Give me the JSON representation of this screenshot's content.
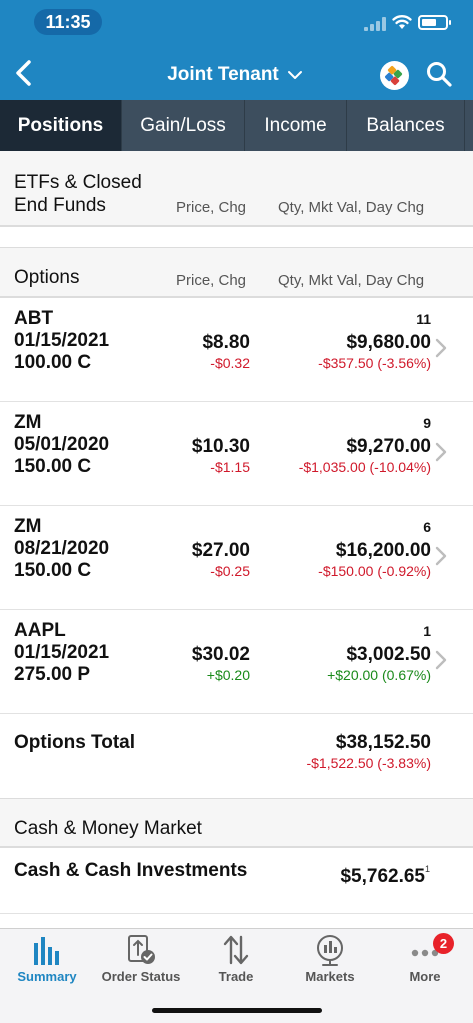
{
  "status_bar": {
    "time": "11:35"
  },
  "header": {
    "title": "Joint Tenant"
  },
  "tabs": [
    {
      "label": "Positions",
      "active": true
    },
    {
      "label": "Gain/Loss",
      "active": false
    },
    {
      "label": "Income",
      "active": false
    },
    {
      "label": "Balances",
      "active": false
    }
  ],
  "etfs": {
    "title_line1": "ETFs & Closed",
    "title_line2": "End Funds",
    "col_price": "Price, Chg",
    "col_value": "Qty, Mkt Val, Day Chg"
  },
  "options": {
    "title": "Options",
    "col_price": "Price, Chg",
    "col_value": "Qty, Mkt Val, Day Chg",
    "rows": [
      {
        "symbol": "ABT",
        "expiry": "01/15/2021",
        "strike": "100.00 C",
        "price": "$8.80",
        "price_chg": "-$0.32",
        "qty": "11",
        "mkt_val": "$9,680.00",
        "day_chg": "-$357.50 (-3.56%)",
        "direction": "neg"
      },
      {
        "symbol": "ZM",
        "expiry": "05/01/2020",
        "strike": "150.00 C",
        "price": "$10.30",
        "price_chg": "-$1.15",
        "qty": "9",
        "mkt_val": "$9,270.00",
        "day_chg": "-$1,035.00 (-10.04%)",
        "direction": "neg"
      },
      {
        "symbol": "ZM",
        "expiry": "08/21/2020",
        "strike": "150.00 C",
        "price": "$27.00",
        "price_chg": "-$0.25",
        "qty": "6",
        "mkt_val": "$16,200.00",
        "day_chg": "-$150.00 (-0.92%)",
        "direction": "neg"
      },
      {
        "symbol": "AAPL",
        "expiry": "01/15/2021",
        "strike": "275.00 P",
        "price": "$30.02",
        "price_chg": "+$0.20",
        "qty": "1",
        "mkt_val": "$3,002.50",
        "day_chg": "+$20.00 (0.67%)",
        "direction": "pos"
      }
    ],
    "total_label": "Options Total",
    "total_value": "$38,152.50",
    "total_chg": "-$1,522.50 (-3.83%)"
  },
  "cash": {
    "title": "Cash & Money Market",
    "label": "Cash & Cash Investments",
    "value": "$5,762.65",
    "footnote": "1"
  },
  "bottom_nav": {
    "items": [
      {
        "label": "Summary",
        "icon": "bar-chart-icon",
        "active": true
      },
      {
        "label": "Order Status",
        "icon": "order-status-icon",
        "active": false
      },
      {
        "label": "Trade",
        "icon": "trade-arrows-icon",
        "active": false
      },
      {
        "label": "Markets",
        "icon": "globe-chart-icon",
        "active": false
      },
      {
        "label": "More",
        "icon": "more-dots-icon",
        "active": false,
        "badge": "2"
      }
    ]
  },
  "colors": {
    "header_blue": "#1f86c2",
    "tab_bar": "#3d4e5e",
    "tab_active": "#1c2936",
    "negative": "#d0192b",
    "positive": "#1a8a1a",
    "badge": "#e8222a"
  }
}
